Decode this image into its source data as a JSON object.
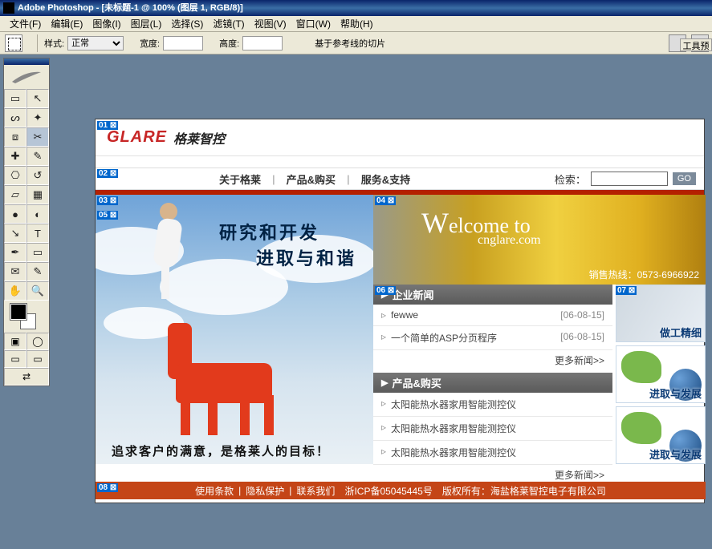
{
  "app_title": "Adobe Photoshop - [未标题-1 @ 100% (图层 1, RGB/8)]",
  "menus": [
    "文件(F)",
    "编辑(E)",
    "图像(I)",
    "图层(L)",
    "选择(S)",
    "滤镜(T)",
    "视图(V)",
    "窗口(W)",
    "帮助(H)"
  ],
  "opts": {
    "label_style": "样式:",
    "style_value": "正常",
    "label_width": "宽度:",
    "label_height": "高度:",
    "slice_info": "基于参考线的切片",
    "side_tab": "工具预设"
  },
  "slices": [
    "01",
    "02",
    "03",
    "04",
    "05",
    "06",
    "07",
    "08"
  ],
  "site": {
    "logo": "GLARE",
    "logo_cn": "格莱智控",
    "nav": [
      "关于格莱",
      "产品&购买",
      "服务&支持"
    ],
    "search_label": "检索：",
    "go": "GO",
    "slogan1": "研究和开发",
    "slogan2": "进取与和谐",
    "hero_bottom": "追求客户的满意，是格莱人的目标！",
    "welcome": "elcome to",
    "domain": "cnglare.com",
    "hotline": "销售热线：0573-6966922",
    "news_hdr": "企业新闻",
    "news": [
      {
        "title": "fewwe",
        "date": "[06-08-15]"
      },
      {
        "title": "一个简单的ASP分页程序",
        "date": "[06-08-15]"
      }
    ],
    "more": "更多新闻>>",
    "prod_hdr": "产品&购买",
    "prods": [
      {
        "title": "太阳能热水器家用智能测控仪"
      },
      {
        "title": "太阳能热水器家用智能测控仪"
      },
      {
        "title": "太阳能热水器家用智能测控仪"
      }
    ],
    "thumbs": [
      "做工精细",
      "进取与发展",
      "进取与发展"
    ],
    "footer": [
      "使用条款",
      "隐私保护",
      "联系我们",
      "浙ICP备05045445号",
      "版权所有：海盐格莱智控电子有限公司"
    ]
  }
}
